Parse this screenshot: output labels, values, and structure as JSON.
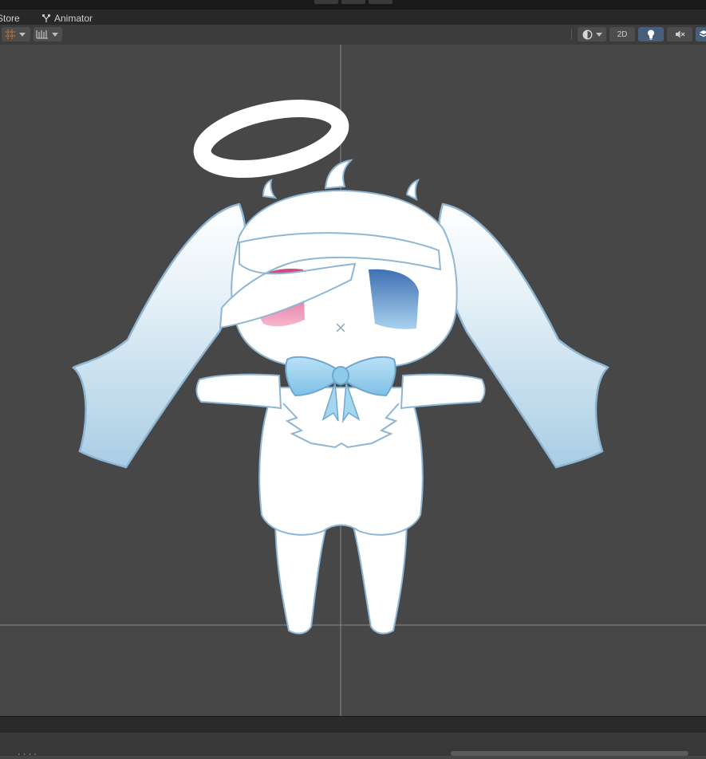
{
  "window": {
    "tabs": [
      {
        "label": "Store",
        "icon": "store-icon"
      },
      {
        "label": "Animator",
        "icon": "animator-icon"
      }
    ]
  },
  "toolbar": {
    "grid_icon": "grid-icon",
    "snap_icon": "snap-ruler-icon",
    "shading_icon": "shading-mode-icon",
    "mode_2d_label": "2D",
    "lighting_icon": "lightbulb-icon",
    "audio_icon": "audio-mute-icon",
    "effects_icon": "effects-layers-icon"
  },
  "scene": {
    "accent_color": "#46607c",
    "character": "chibi angel character model with halo, long ears and blue bow"
  },
  "bottom": {
    "partial_text": "· · ·  ·"
  }
}
